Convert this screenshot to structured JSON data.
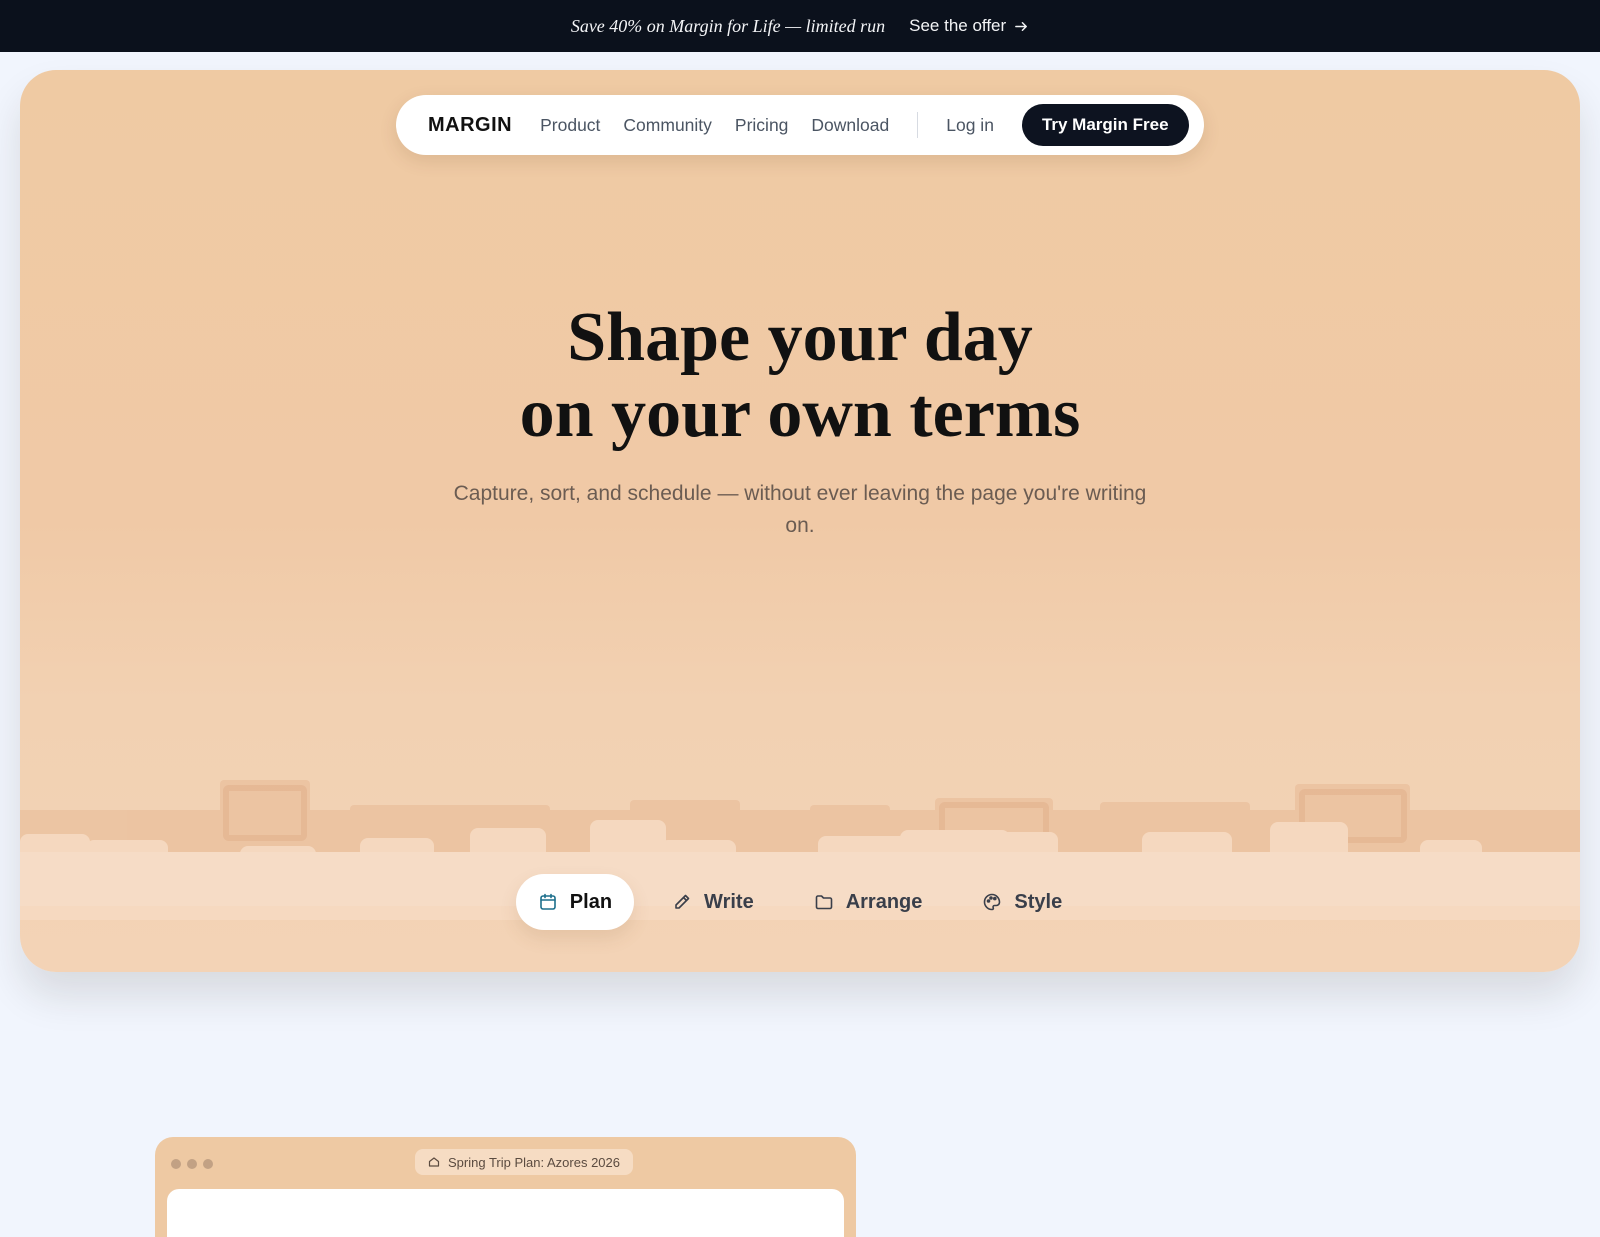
{
  "announcement": {
    "promo_text": "Save 40% on Margin for Life — limited run",
    "offer_link": "See the offer",
    "offer_icon": "arrow-right-icon"
  },
  "nav": {
    "brand": "MARGIN",
    "links": [
      "Product",
      "Community",
      "Pricing",
      "Download"
    ],
    "login": "Log in",
    "cta": "Try Margin Free"
  },
  "hero": {
    "headline_line1": "Shape your day",
    "headline_line2": "on your own terms",
    "subhead": "Capture, sort, and schedule — without ever leaving the page you're writing on."
  },
  "tabs": [
    {
      "label": "Plan",
      "icon": "calendar-icon",
      "active": true
    },
    {
      "label": "Write",
      "icon": "pencil-icon",
      "active": false
    },
    {
      "label": "Arrange",
      "icon": "folder-icon",
      "active": false
    },
    {
      "label": "Style",
      "icon": "palette-icon",
      "active": false
    }
  ],
  "preview": {
    "doc_title": "Spring Trip Plan: Azores 2026",
    "doc_icon": "home-icon"
  },
  "colors": {
    "announcement_bg": "#0b111c",
    "hero_bg": "#efcaa3",
    "cta_bg": "#0d1320",
    "page_bg": "#f1f5fd"
  }
}
